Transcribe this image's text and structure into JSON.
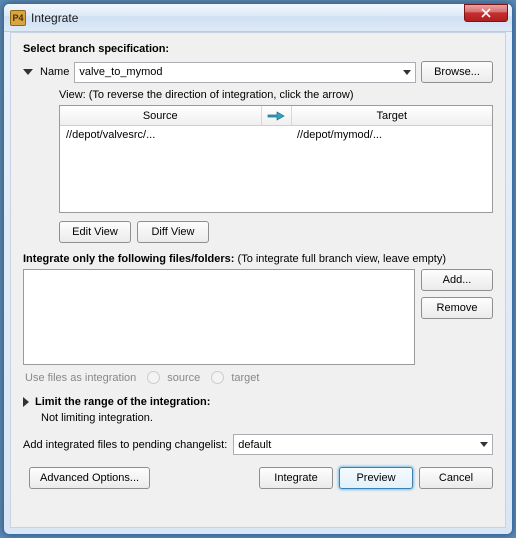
{
  "window": {
    "title": "Integrate",
    "icon_label": "P4"
  },
  "branch": {
    "header": "Select branch specification:",
    "name_label": "Name",
    "name_value": "valve_to_mymod",
    "browse": "Browse...",
    "view_hint": "View: (To reverse the direction of integration, click the arrow)",
    "columns": {
      "source": "Source",
      "target": "Target"
    },
    "rows": [
      {
        "source": "//depot/valvesrc/...",
        "target": "//depot/mymod/..."
      }
    ],
    "edit_view": "Edit View",
    "diff_view": "Diff View"
  },
  "files": {
    "header": "Integrate only the following files/folders:",
    "hint": "(To integrate full branch view, leave empty)",
    "add": "Add...",
    "remove": "Remove",
    "use_files_label": "Use files as integration",
    "radio_source": "source",
    "radio_target": "target"
  },
  "limit": {
    "header": "Limit the range of the integration:",
    "status": "Not limiting integration."
  },
  "changelist": {
    "label": "Add integrated files to pending changelist:",
    "value": "default"
  },
  "footer": {
    "advanced": "Advanced Options...",
    "integrate": "Integrate",
    "preview": "Preview",
    "cancel": "Cancel"
  }
}
